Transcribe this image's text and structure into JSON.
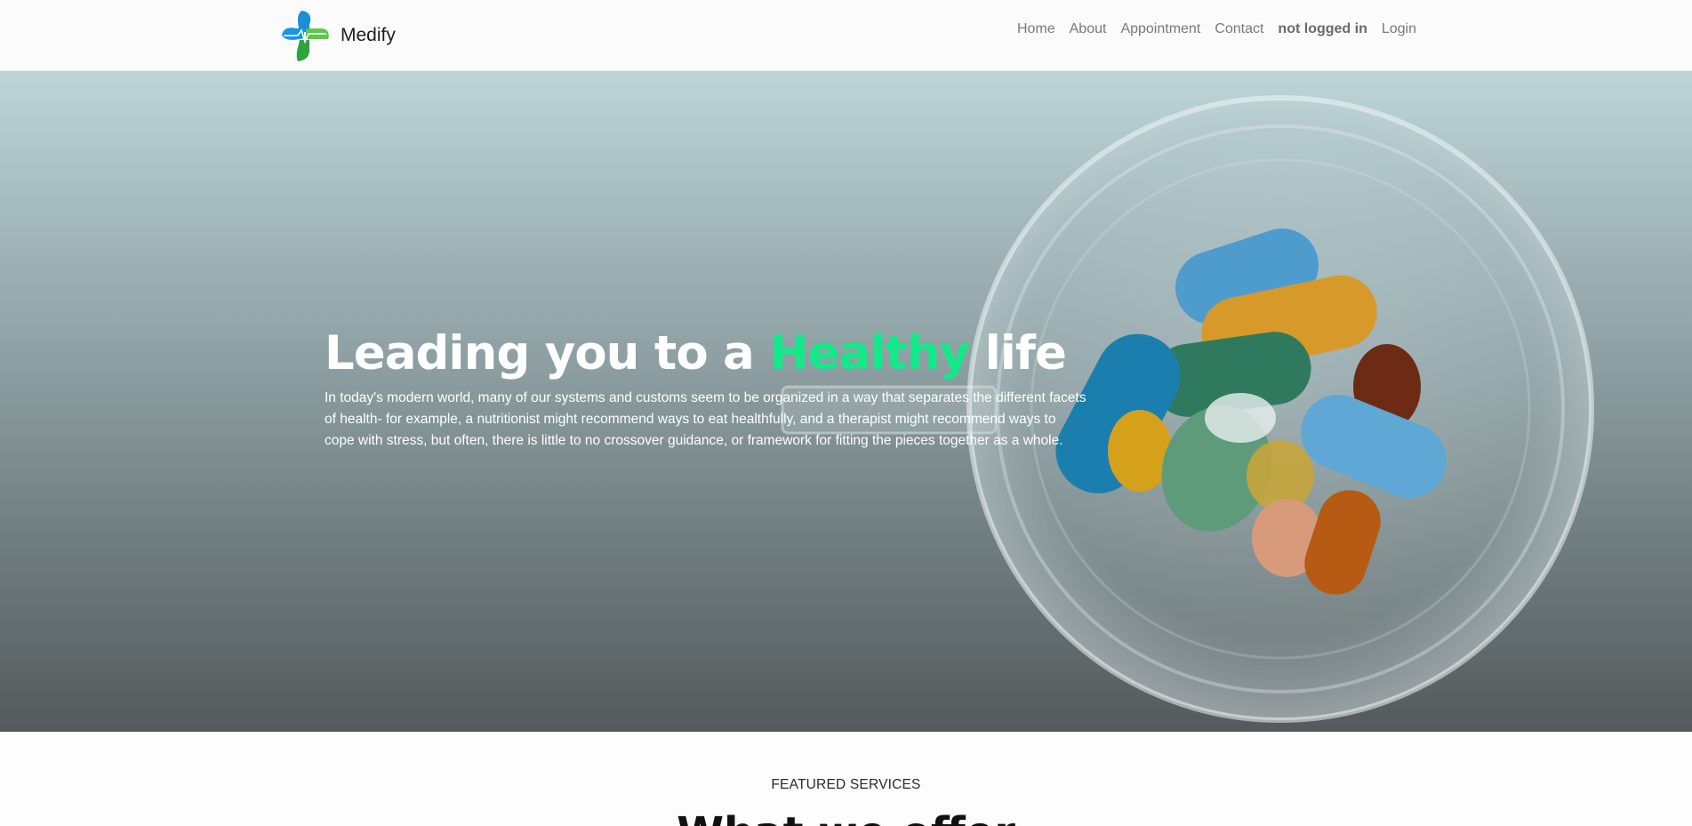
{
  "brand": {
    "name": "Medify",
    "logo_icon": "medical-cross-logo-icon"
  },
  "nav": {
    "home": "Home",
    "about": "About",
    "appointment": "Appointment",
    "contact": "Contact",
    "status": "not logged in",
    "login": "Login"
  },
  "hero": {
    "title_before": "Leading you to a ",
    "title_accent": "Healthy",
    "title_after": " life",
    "accent_color": "#12ea8a",
    "paragraph": "In today's modern world, many of our systems and customs seem to be organized in a way that separates the different facets of health- for example, a nutritionist might recommend ways to eat healthfully, and a therapist might recommend ways to cope with stress, but often, there is little to no crossover guidance, or framework for fitting the pieces together as a whole.",
    "image": "pills-in-glass-bowl"
  },
  "featured": {
    "label": "FEATURED SERVICES",
    "heading": "What we offer"
  }
}
